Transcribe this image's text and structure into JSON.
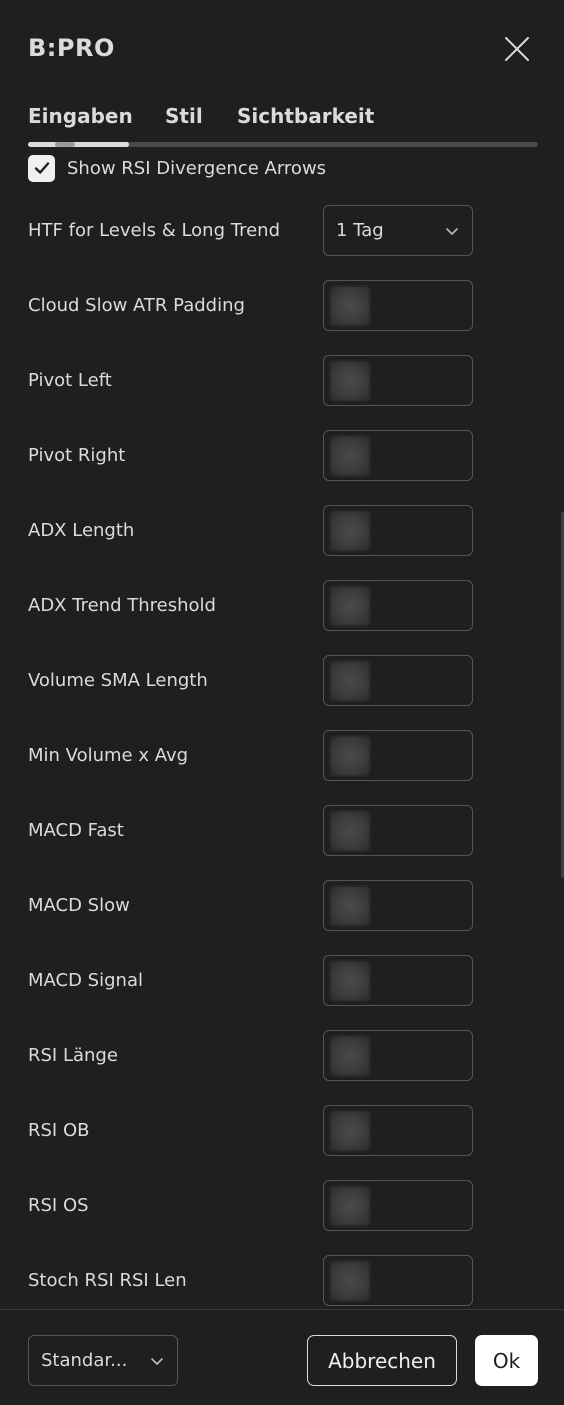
{
  "dialog": {
    "title": "B:PRO",
    "close_icon": "close-icon"
  },
  "tabs": [
    {
      "label": "Eingaben",
      "active": true
    },
    {
      "label": "Stil",
      "active": false
    },
    {
      "label": "Sichtbarkeit",
      "active": false
    }
  ],
  "checkbox": {
    "label": "Show RSI Divergence Arrows",
    "checked": true
  },
  "settings": [
    {
      "label": "HTF for Levels & Long Trend",
      "type": "select",
      "value": "1 Tag"
    },
    {
      "label": "Cloud Slow ATR Padding",
      "type": "number"
    },
    {
      "label": "Pivot Left",
      "type": "number"
    },
    {
      "label": "Pivot Right",
      "type": "number"
    },
    {
      "label": "ADX Length",
      "type": "number"
    },
    {
      "label": "ADX Trend Threshold",
      "type": "number"
    },
    {
      "label": "Volume SMA Length",
      "type": "number"
    },
    {
      "label": "Min Volume x Avg",
      "type": "number"
    },
    {
      "label": "MACD Fast",
      "type": "number"
    },
    {
      "label": "MACD Slow",
      "type": "number"
    },
    {
      "label": "MACD Signal",
      "type": "number"
    },
    {
      "label": "RSI Länge",
      "type": "number"
    },
    {
      "label": "RSI OB",
      "type": "number"
    },
    {
      "label": "RSI OS",
      "type": "number"
    },
    {
      "label": "Stoch RSI RSI Len",
      "type": "number"
    }
  ],
  "footer": {
    "preset_value": "Standar...",
    "cancel_label": "Abbrechen",
    "ok_label": "Ok"
  },
  "colors": {
    "background": "#1f1f1f",
    "text": "#dbdbdb",
    "border": "#555555",
    "ok_bg": "#ffffff"
  }
}
